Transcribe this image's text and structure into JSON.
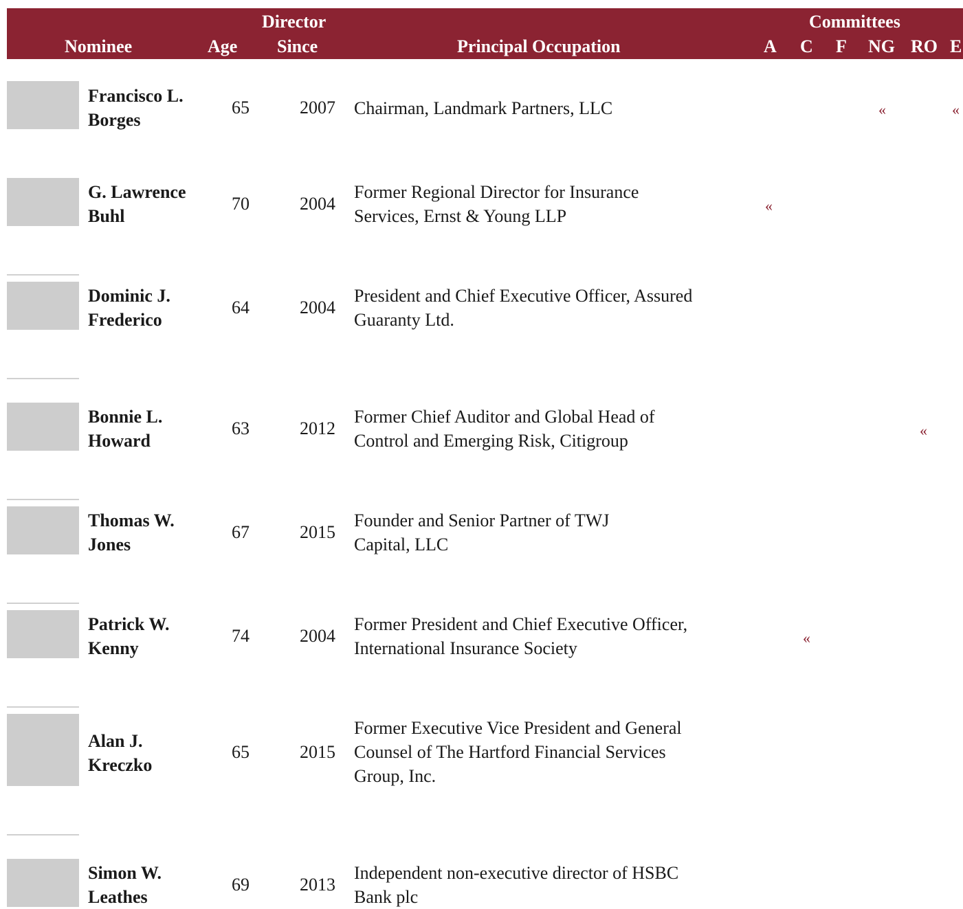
{
  "header": {
    "nominee": "Nominee",
    "age": "Age",
    "director": "Director",
    "since": "Since",
    "occupation": "Principal Occupation",
    "committees": "Committees",
    "committee_codes": [
      "A",
      "C",
      "F",
      "NG",
      "RO",
      "E"
    ]
  },
  "chair_mark": "«",
  "nominees": [
    {
      "name_line1": "Francisco L.",
      "name_line2": "Borges",
      "age": "65",
      "since": "2007",
      "occupation": [
        "Chairman, Landmark Partners, LLC"
      ],
      "chair_of": [
        "NG",
        "E"
      ]
    },
    {
      "name_line1": "G. Lawrence",
      "name_line2": "Buhl",
      "age": "70",
      "since": "2004",
      "occupation": [
        "Former Regional Director for Insurance",
        "Services, Ernst & Young LLP"
      ],
      "chair_of": [
        "A"
      ]
    },
    {
      "name_line1": "Dominic J.",
      "name_line2": "Frederico",
      "age": "64",
      "since": "2004",
      "occupation": [
        "President and Chief Executive Officer, Assured",
        "Guaranty Ltd."
      ],
      "chair_of": []
    },
    {
      "name_line1": "Bonnie L.",
      "name_line2": "Howard",
      "age": "63",
      "since": "2012",
      "occupation": [
        "Former Chief Auditor and Global Head of",
        "Control and Emerging Risk, Citigroup"
      ],
      "chair_of": [
        "RO"
      ]
    },
    {
      "name_line1": "Thomas W.",
      "name_line2": "Jones",
      "age": "67",
      "since": "2015",
      "occupation": [
        "Founder and Senior Partner of TWJ",
        "Capital, LLC"
      ],
      "chair_of": []
    },
    {
      "name_line1": "Patrick W.",
      "name_line2": "Kenny",
      "age": "74",
      "since": "2004",
      "occupation": [
        "Former President and Chief Executive Officer,",
        "International Insurance Society"
      ],
      "chair_of": [
        "C"
      ]
    },
    {
      "name_line1": "Alan J.",
      "name_line2": "Kreczko",
      "age": "65",
      "since": "2015",
      "occupation": [
        "Former Executive Vice President and General",
        "Counsel of The Hartford Financial Services",
        "Group, Inc."
      ],
      "chair_of": []
    },
    {
      "name_line1": "Simon W.",
      "name_line2": "Leathes",
      "age": "69",
      "since": "2013",
      "occupation": [
        "Independent non-executive director of HSBC",
        "Bank plc"
      ],
      "chair_of": []
    }
  ]
}
